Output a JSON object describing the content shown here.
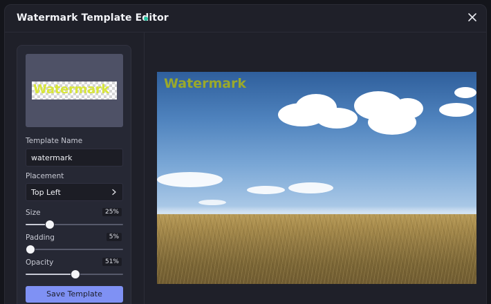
{
  "window": {
    "title": "Watermark Template Editor"
  },
  "preview": {
    "watermark_text": "Watermark"
  },
  "form": {
    "template_name_label": "Template Name",
    "template_name_value": "watermark",
    "placement_label": "Placement",
    "placement_value": "Top Left"
  },
  "sliders": [
    {
      "label": "Size",
      "value_text": "25%",
      "value": 25
    },
    {
      "label": "Padding",
      "value_text": "5%",
      "value": 5
    },
    {
      "label": "Opacity",
      "value_text": "51%",
      "value": 51
    }
  ],
  "actions": {
    "save_label": "Save Template"
  },
  "canvas": {
    "watermark_text": "Watermark"
  },
  "colors": {
    "accent": "#7f91f4",
    "status_dot": "#25c2a0",
    "watermark": "#d8e63b"
  },
  "icons": {
    "close": "close-icon",
    "chevron": "chevron-right-icon"
  }
}
